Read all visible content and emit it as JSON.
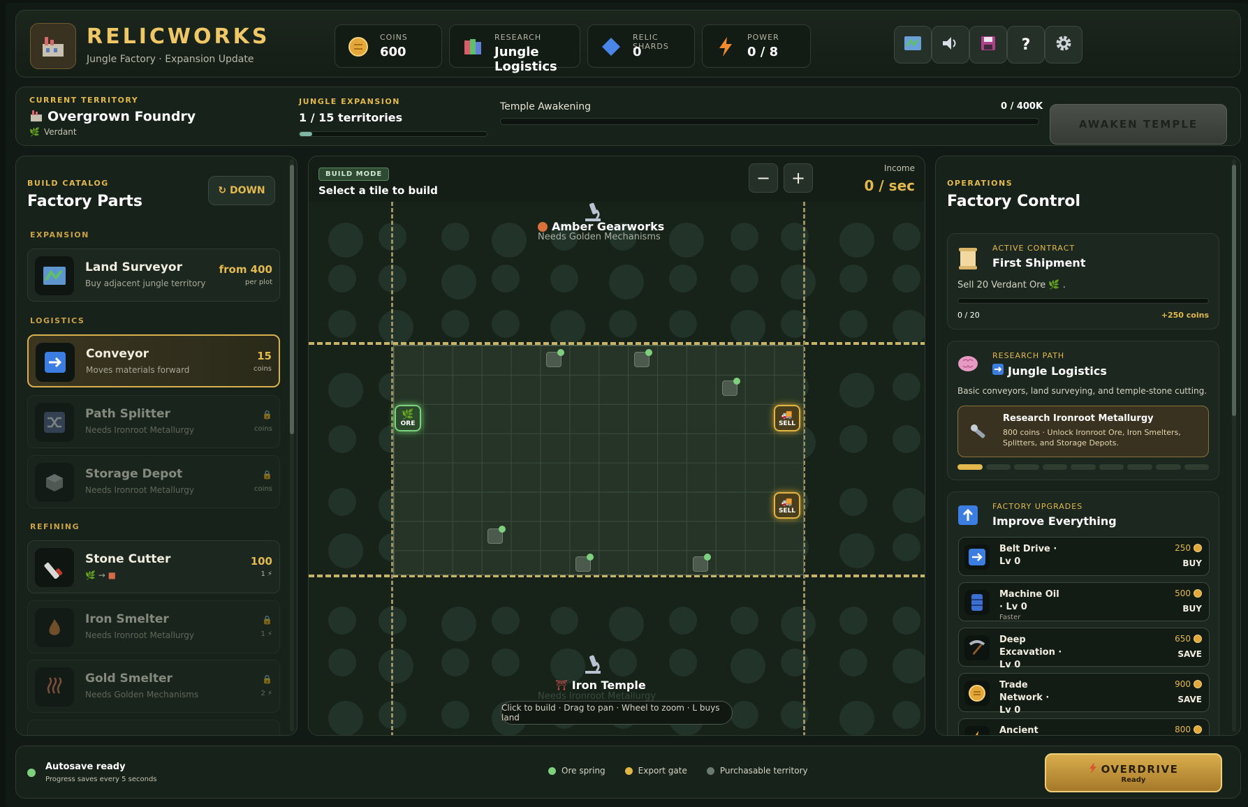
{
  "app": {
    "title": "RELICWORKS",
    "subtitle": "Jungle Factory · Expansion Update"
  },
  "stats": {
    "coins": {
      "label": "COINS",
      "value": "600"
    },
    "research": {
      "label": "RESEARCH",
      "value": "Jungle Logistics"
    },
    "shards": {
      "label": "RELIC SHARDS",
      "value": "0"
    },
    "power": {
      "label": "POWER",
      "value": "0 / 8"
    }
  },
  "toolbar": {
    "map": "map-icon",
    "sound": "sound-icon",
    "save": "save-icon",
    "help_label": "?",
    "settings": "gear-icon"
  },
  "territory": {
    "label": "CURRENT TERRITORY",
    "name": "Overgrown Foundry",
    "biome": "Verdant",
    "expansion_label": "JUNGLE EXPANSION",
    "expansion_value": "1 / 15 territories",
    "expansion_progress": 0.067,
    "temple_label": "Temple Awakening",
    "temple_value": "0 / 400K",
    "temple_progress": 0,
    "awaken_button": "AWAKEN TEMPLE"
  },
  "catalog": {
    "label": "BUILD CATALOG",
    "title": "Factory Parts",
    "sort_button": "↻ DOWN",
    "sections": {
      "expansion": "EXPANSION",
      "logistics": "LOGISTICS",
      "refining": "REFINING"
    },
    "items": [
      {
        "name": "Land Surveyor",
        "desc": "Buy adjacent jungle territory",
        "price": "from 400",
        "unit": "per plot"
      },
      {
        "name": "Conveyor",
        "desc": "Moves materials forward",
        "price": "15",
        "unit": "coins"
      },
      {
        "name": "Path Splitter",
        "desc": "Needs Ironroot Metallurgy",
        "unit": "coins"
      },
      {
        "name": "Storage Depot",
        "desc": "Needs Ironroot Metallurgy",
        "unit": "coins"
      },
      {
        "name": "Stone Cutter",
        "price": "100",
        "unit": "1 ⚡"
      },
      {
        "name": "Iron Smelter",
        "desc": "Needs Ironroot Metallurgy",
        "unit": "1 ⚡"
      },
      {
        "name": "Gold Smelter",
        "desc": "Needs Golden Mechanisms",
        "unit": "2 ⚡"
      }
    ]
  },
  "board": {
    "mode_badge": "BUILD MODE",
    "mode_text": "Select a tile to build",
    "zoom_out": "−",
    "zoom_in": "+",
    "income_label": "Income",
    "income_value": "0 / sec",
    "north_name": "Amber Gearworks",
    "north_req": "Needs Golden Mechanisms",
    "south_name": "Iron Temple",
    "south_req": "Needs Ironroot Metallurgy",
    "ore_label": "ORE",
    "sell_label": "SELL",
    "hint": "Click to build · Drag to pan · Wheel to zoom · L buys land"
  },
  "operations": {
    "label": "OPERATIONS",
    "title": "Factory Control",
    "contract": {
      "label": "ACTIVE CONTRACT",
      "title": "First Shipment",
      "desc": "Sell 20 Verdant Ore 🌿 .",
      "progress_text": "0 / 20",
      "progress": 0,
      "reward": "+250 coins"
    },
    "research": {
      "label": "RESEARCH PATH",
      "title": "Jungle Logistics",
      "desc": "Basic conveyors, land surveying, and temple-stone cutting.",
      "next_title": "Research Ironroot Metallurgy",
      "next_desc": "800 coins · Unlock Ironroot Ore, Iron Smelters, Splitters, and Storage Depots.",
      "steps_total": 9,
      "steps_done": 1
    },
    "upgrades": {
      "label": "FACTORY UPGRADES",
      "title": "Improve Everything",
      "items": [
        {
          "name": "Belt Drive · Lv 0",
          "price": "250",
          "action": "BUY"
        },
        {
          "name": "Machine Oil · Lv 0",
          "sub": "Faster",
          "price": "500",
          "action": "BUY"
        },
        {
          "name": "Deep Excavation · Lv 0",
          "price": "650",
          "action": "SAVE"
        },
        {
          "name": "Trade Network · Lv 0",
          "price": "900",
          "action": "SAVE"
        },
        {
          "name": "Ancient",
          "price": "800"
        }
      ]
    }
  },
  "footer": {
    "autosave_title": "Autosave ready",
    "autosave_sub": "Progress saves every 5 seconds",
    "legend": [
      "Ore spring",
      "Export gate",
      "Purchasable territory"
    ],
    "overdrive_label": "OVERDRIVE",
    "overdrive_status": "Ready"
  },
  "colors": {
    "accent": "#e3b94e",
    "ore": "#7ed07e",
    "export": "#e0b544",
    "territory": "#6b7a6e",
    "bg": "#111a14"
  }
}
